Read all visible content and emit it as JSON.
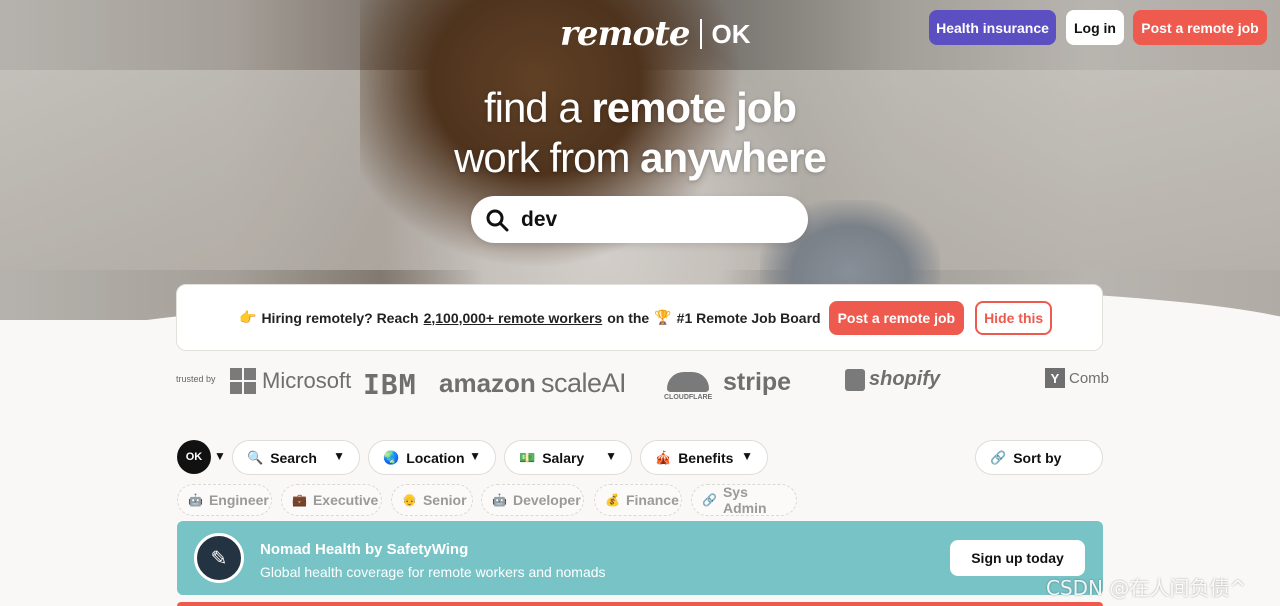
{
  "header": {
    "logo_word": "remote",
    "logo_ok": "OK",
    "health_insurance": "Health insurance",
    "log_in": "Log in",
    "post_job": "Post a remote job"
  },
  "hero": {
    "line1_light": "find a",
    "line1_bold": "remote job",
    "line2_light": "work from",
    "line2_bold": "anywhere"
  },
  "search": {
    "value": "dev"
  },
  "banner": {
    "emoji_hand": "👉",
    "text_a": "Hiring remotely? Reach",
    "link": "2,100,000+ remote workers",
    "text_b": "on the",
    "emoji_trophy": "🏆",
    "text_c": "#1 Remote Job Board",
    "post_btn": "Post a remote job",
    "hide_btn": "Hide this"
  },
  "trusted": {
    "label": "trusted by",
    "brands": [
      "Microsoft",
      "IBM",
      "amazon",
      "scaleAI",
      "CLOUDFLARE",
      "stripe",
      "shopify",
      "Y",
      "Comb"
    ]
  },
  "filters": {
    "ok_badge": "OK",
    "search": "Search",
    "location": "Location",
    "salary": "Salary",
    "benefits": "Benefits",
    "sort": "Sort by"
  },
  "tags": [
    "Engineer",
    "Executive",
    "Senior",
    "Developer",
    "Finance",
    "Sys Admin"
  ],
  "promo": {
    "title": "Nomad Health by SafetyWing",
    "subtitle": "Global health coverage for remote workers and nomads",
    "button": "Sign up today"
  },
  "watermark": "CSDN @在人间负债^",
  "colors": {
    "brand_red": "#ef5a4e",
    "health_purple": "#5b4fc2",
    "promo_teal": "#78c3c6"
  }
}
